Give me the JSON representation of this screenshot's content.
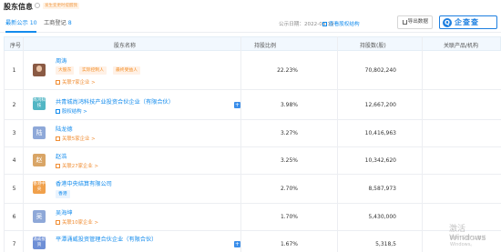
{
  "header": {
    "title": "股东信息",
    "badge": "发生变更时提醒我"
  },
  "tabs": [
    {
      "label": "最新公示",
      "count": "10"
    },
    {
      "label": "工商登记",
      "count": "8"
    }
  ],
  "toolbar": {
    "publish_date": "公示日期：2022-04-19",
    "structure_link": "查看股权结构",
    "export_label": "导出数据",
    "brand_logo_char": "Q",
    "brand_name": "企查查"
  },
  "table": {
    "columns": [
      "序号",
      "股东名称",
      "持股比例",
      "持股数(股)",
      "关联产品/机构"
    ],
    "rows": [
      {
        "index": "1",
        "name": "周涛",
        "avatar_text": "",
        "avatar_color": "#8a5a44",
        "tags": [
          "大股东",
          "实际控制人",
          "最终受益人"
        ],
        "sub": "关联7家企业 >",
        "plus": false,
        "ratio": "22.23%",
        "amount": "70,802,240"
      },
      {
        "index": "2",
        "name": "共青城尚鸿科技产业投资合伙企业（有限合伙）",
        "avatar_text": "尚鸿科技",
        "avatar_color": "#52b6c4",
        "tags": [],
        "sub": "股权结构 >",
        "plus": true,
        "ratio": "3.98%",
        "amount": "12,667,200"
      },
      {
        "index": "3",
        "name": "陆龙德",
        "avatar_text": "陆",
        "avatar_color": "#8ea8d8",
        "tags": [],
        "sub": "关联5家企业 >",
        "plus": false,
        "ratio": "3.27%",
        "amount": "10,416,963"
      },
      {
        "index": "4",
        "name": "赵浩",
        "avatar_text": "赵",
        "avatar_color": "#d9a566",
        "tags": [],
        "sub": "关联27家企业 >",
        "plus": false,
        "ratio": "3.25%",
        "amount": "10,342,620"
      },
      {
        "index": "5",
        "name": "香港中央结算有限公司",
        "avatar_text": "香港中央",
        "avatar_color": "#f0a04b",
        "tags": [
          "香港"
        ],
        "sub": "",
        "plus": false,
        "ratio": "2.70%",
        "amount": "8,587,973"
      },
      {
        "index": "6",
        "name": "吴海坤",
        "avatar_text": "吴",
        "avatar_color": "#8ea8d8",
        "tags": [],
        "sub": "关联10家企业 >",
        "plus": false,
        "ratio": "1.70%",
        "amount": "5,430,000"
      },
      {
        "index": "7",
        "name": "平潭涌威投资管理合伙企业（有限合伙）",
        "avatar_text": "涌威投资",
        "avatar_color": "#6e8fd6",
        "tags": [],
        "sub": "",
        "plus": true,
        "ratio": "1.67%",
        "amount": "5,318,5"
      }
    ]
  },
  "watermark": {
    "line1": "激活 Windows",
    "line2": "转到\"设置\"以激活 Windows。"
  }
}
